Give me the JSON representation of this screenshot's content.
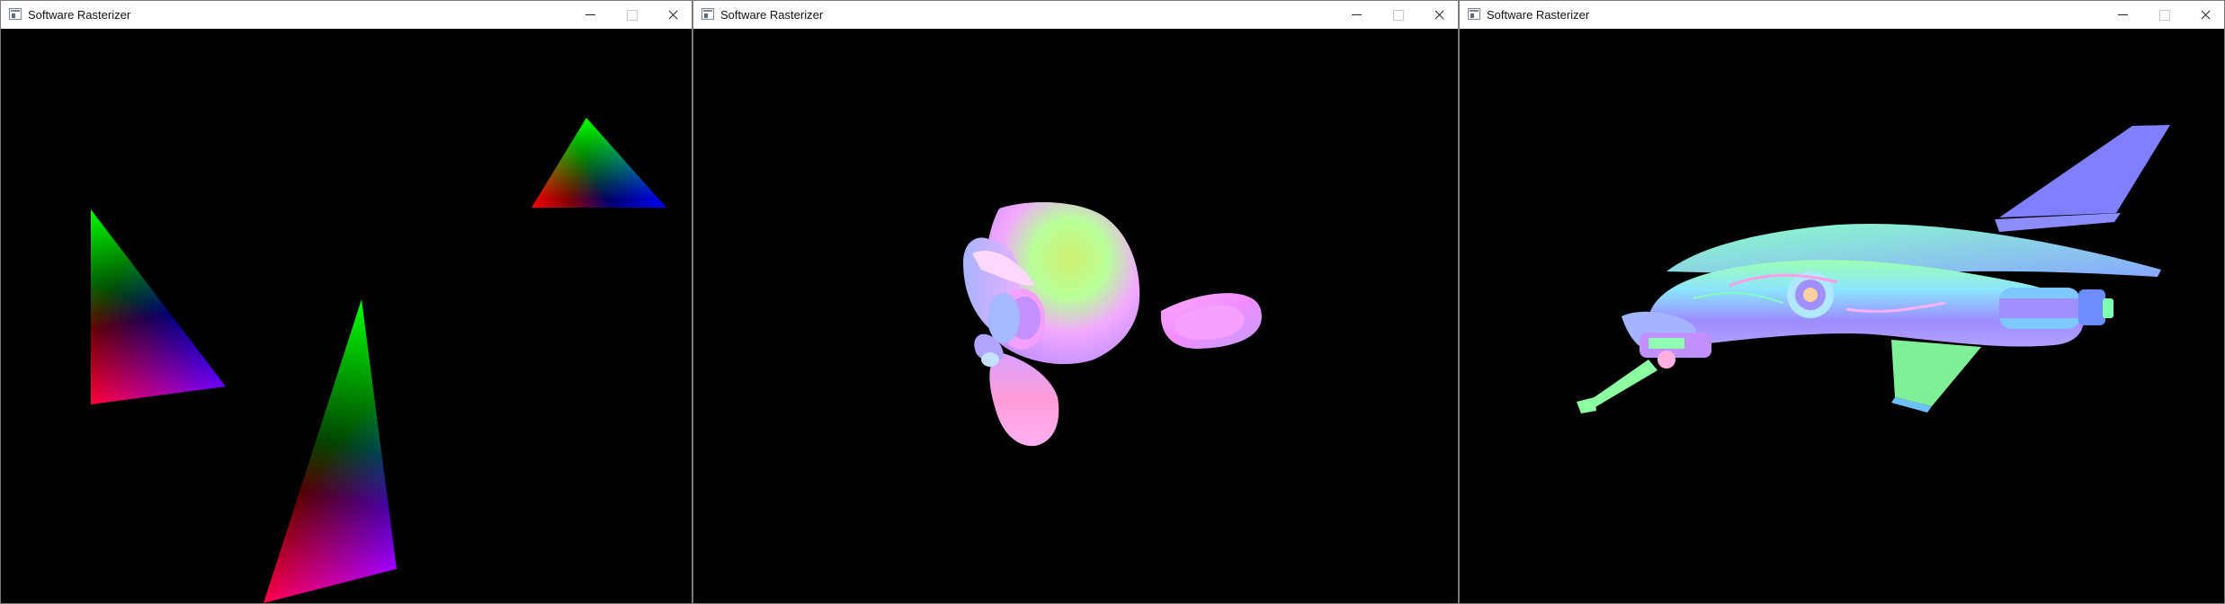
{
  "windows": [
    {
      "title": "Software Rasterizer",
      "scene": "colored-triangles"
    },
    {
      "title": "Software Rasterizer",
      "scene": "monkey-head"
    },
    {
      "title": "Software Rasterizer",
      "scene": "spaceship"
    }
  ],
  "controls": {
    "minimize": "minimize",
    "maximize": "maximize",
    "close": "close"
  },
  "colors": {
    "background": "#000000",
    "titlebar": "#ffffff",
    "border": "#7a7a7a"
  }
}
